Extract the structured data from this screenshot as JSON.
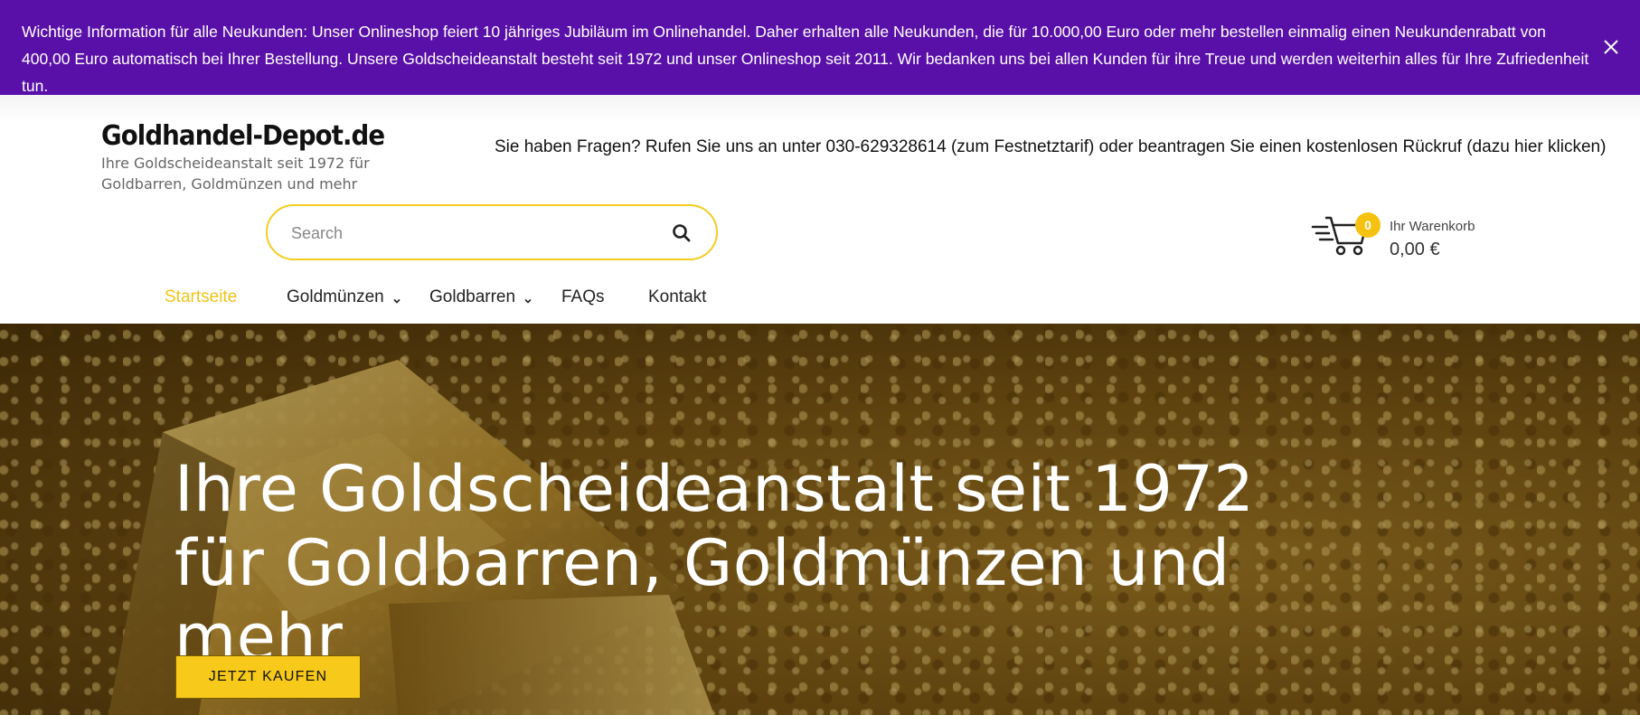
{
  "notice": {
    "text": "Wichtige Information für alle Neukunden: Unser Onlineshop feiert 10 jähriges Jubiläum im Onlinehandel. Daher erhalten alle Neukunden, die für 10.000,00 Euro oder mehr bestellen einmalig einen Neukundenrabatt von 400,00 Euro automatisch bei Ihrer Bestellung. Unsere Goldscheideanstalt besteht seit 1972 und unser Onlineshop seit 2011. Wir bedanken uns bei allen Kunden für ihre Treue und werden weiterhin alles für Ihre Zufriedenheit tun.",
    "close_icon": "close-icon",
    "background": "#5910a8"
  },
  "header": {
    "logo_title": "Goldhandel-Depot.de",
    "logo_subtitle": "Ihre Goldscheideanstalt seit 1972 für Goldbarren, Goldmünzen und mehr",
    "contact": "Sie haben Fragen? Rufen Sie uns an unter 030-629328614 (zum Festnetztarif) oder beantragen Sie einen kostenlosen Rückruf (dazu hier klicken)",
    "search": {
      "placeholder": "Search",
      "value": "",
      "icon": "search-icon"
    },
    "cart": {
      "count": "0",
      "label": "Ihr Warenkorb",
      "total": "0,00 €",
      "icon": "cart-icon"
    }
  },
  "nav": {
    "items": [
      {
        "label": "Startseite",
        "active": true
      },
      {
        "label": "Goldmünzen",
        "dropdown": true
      },
      {
        "label": "Goldbarren",
        "dropdown": true
      },
      {
        "label": "FAQs"
      },
      {
        "label": "Kontakt"
      }
    ]
  },
  "hero": {
    "title": "Ihre Goldscheideanstalt seit 1972 für Goldbarren, Goldmünzen und mehr",
    "button": "JETZT KAUFEN"
  },
  "colors": {
    "accent": "#f2c318",
    "button": "#f7c91a"
  }
}
